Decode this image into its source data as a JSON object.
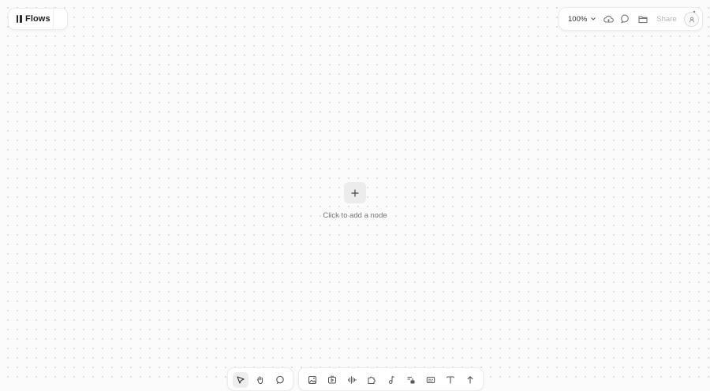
{
  "brand": {
    "label": "Flows"
  },
  "toolbar": {
    "zoom_label": "100%",
    "share_label": "Share",
    "icons": [
      "cloud-icon",
      "comment-icon",
      "folder-icon"
    ]
  },
  "canvas": {
    "add_node_hint": "Click to add a node"
  },
  "bottom_toolbar": {
    "left_tools": [
      "pointer-tool",
      "hand-tool",
      "lasso-tool"
    ],
    "right_tools": [
      "image-node",
      "video-node",
      "audio-node",
      "plugin-node",
      "music-node",
      "text-style-node",
      "caption-node",
      "text-tool",
      "upload-tool"
    ],
    "active_tool": "pointer-tool"
  },
  "colors": {
    "background": "#fbfbfb",
    "grid_dot": "#d9d9d9",
    "panel": "#ffffff",
    "muted_text": "#777777"
  }
}
